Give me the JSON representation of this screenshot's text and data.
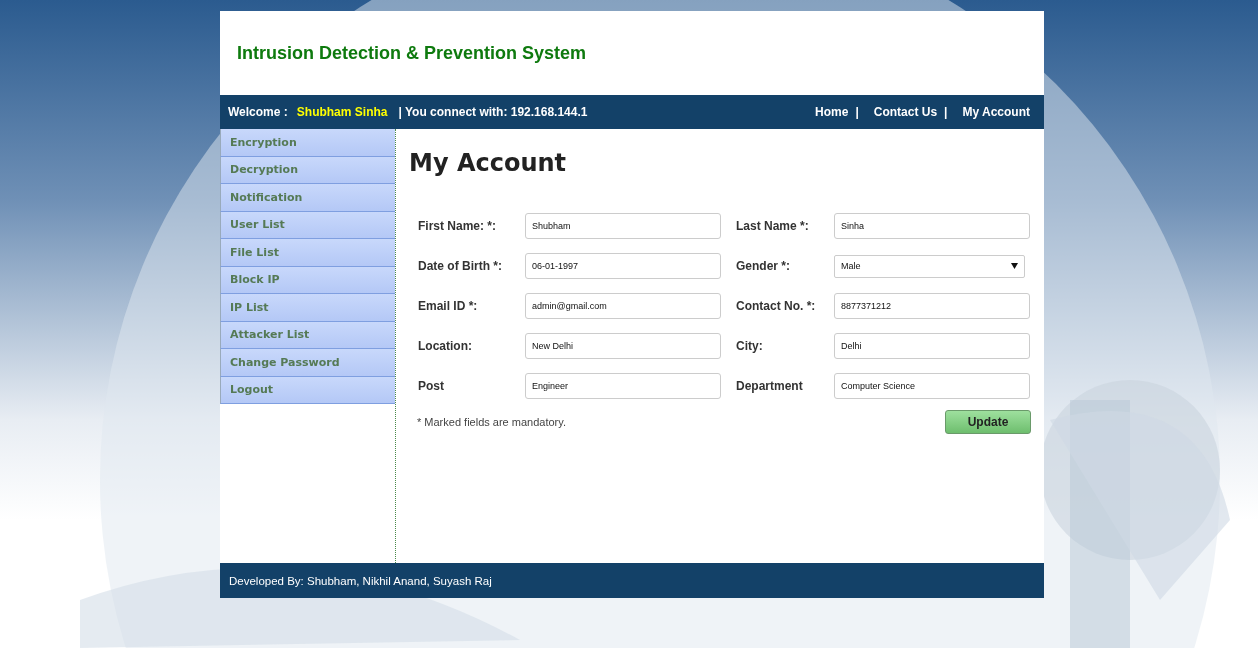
{
  "header": {
    "title": "Intrusion Detection & Prevention System"
  },
  "nav": {
    "welcome_label": "Welcome :",
    "user_name": "Shubham Sinha",
    "connect_text": "| You connect with: 192.168.144.1",
    "links": [
      {
        "label": "Home",
        "separator": "|"
      },
      {
        "label": "Contact Us",
        "separator": "|"
      },
      {
        "label": "My Account"
      }
    ]
  },
  "sidebar": {
    "items": [
      "Encryption",
      "Decryption",
      "Notification",
      "User List",
      "File List",
      "Block IP",
      "IP List",
      "Attacker List",
      "Change Password",
      "Logout"
    ]
  },
  "page": {
    "title": "My Account",
    "fields": [
      {
        "label": "First Name: *:",
        "value": "Shubham",
        "kind": "text"
      },
      {
        "label": "Last Name *:",
        "value": "Sinha",
        "kind": "text"
      },
      {
        "label": "Date of Birth *:",
        "value": "06-01-1997",
        "kind": "text"
      },
      {
        "label": "Gender *:",
        "value": "Male",
        "kind": "select"
      },
      {
        "label": "Email ID *:",
        "value": "admin@gmail.com",
        "kind": "text"
      },
      {
        "label": "Contact No. *:",
        "value": "8877371212",
        "kind": "text"
      },
      {
        "label": "Location:",
        "value": "New Delhi",
        "kind": "text"
      },
      {
        "label": "City:",
        "value": "Delhi",
        "kind": "text"
      },
      {
        "label": "Post",
        "value": "Engineer",
        "kind": "text"
      },
      {
        "label": "Department",
        "value": "Computer Science",
        "kind": "text"
      }
    ],
    "note": "* Marked fields are mandatory.",
    "update_button": "Update"
  },
  "footer": {
    "text": "Developed By: Shubham, Nikhil Anand, Suyash Raj"
  }
}
